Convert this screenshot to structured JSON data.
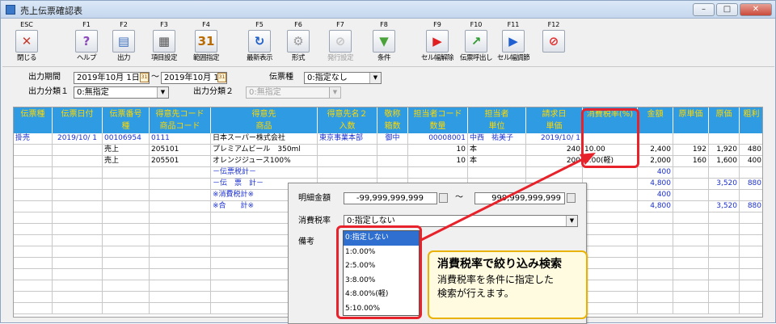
{
  "window": {
    "title": "売上伝票確認表",
    "min": "–",
    "max": "□",
    "close": "✕"
  },
  "toolbar": [
    {
      "key": "ESC",
      "label": "閉じる",
      "icon": "exit-icon",
      "glyph": "✕",
      "color": "#c23a2b",
      "enabled": true
    },
    {
      "key": "F1",
      "label": "ヘルプ",
      "icon": "help-icon",
      "glyph": "?",
      "color": "#8a4ab8",
      "enabled": true
    },
    {
      "key": "F2",
      "label": "出力",
      "icon": "output-icon",
      "glyph": "▤",
      "color": "#3b6fbf",
      "enabled": true
    },
    {
      "key": "F3",
      "label": "項目設定",
      "icon": "column-settings-icon",
      "glyph": "▦",
      "color": "#555555",
      "enabled": true
    },
    {
      "key": "F4",
      "label": "範囲指定",
      "icon": "calendar-icon",
      "glyph": "31",
      "color": "#b86b00",
      "enabled": true
    },
    {
      "key": "F5",
      "label": "最新表示",
      "icon": "refresh-icon",
      "glyph": "↻",
      "color": "#1f5fc8",
      "enabled": true
    },
    {
      "key": "F6",
      "label": "形式",
      "icon": "gear-icon",
      "glyph": "⚙",
      "color": "#9a9a9a",
      "enabled": true
    },
    {
      "key": "F7",
      "label": "発行設定",
      "icon": "disabled-icon",
      "glyph": "⊘",
      "color": "#c4c4c4",
      "enabled": false
    },
    {
      "key": "F8",
      "label": "条件",
      "icon": "filter-icon",
      "glyph": "▼",
      "color": "#4aa33a",
      "enabled": true
    },
    {
      "key": "F9",
      "label": "セル幅解除",
      "icon": "play-red-icon",
      "glyph": "▶",
      "color": "#e02020",
      "enabled": true
    },
    {
      "key": "F10",
      "label": "伝票呼出し",
      "icon": "arrow-up-icon",
      "glyph": "↗",
      "color": "#2f9a2f",
      "enabled": true
    },
    {
      "key": "F11",
      "label": "セル幅調節",
      "icon": "play-blue-icon",
      "glyph": "▶",
      "color": "#1f5fd0",
      "enabled": true
    },
    {
      "key": "F12",
      "label": "",
      "icon": "stop-icon",
      "glyph": "⊘",
      "color": "#e03030",
      "enabled": true
    }
  ],
  "params": {
    "period_label": "出力期間",
    "period_from": "2019年10月 1日",
    "period_sep": "〜",
    "period_to": "2019年10月 1日",
    "slip_type_label": "伝票種",
    "slip_type_value": "0:指定なし",
    "class1_label": "出力分類１",
    "class1_value": "0:無指定",
    "class2_label": "出力分類２",
    "class2_value": "0:無指定",
    "cal_glyph": "31",
    "arrow": "▼"
  },
  "grid": {
    "headers": [
      {
        "l1": "伝票種",
        "l2": ""
      },
      {
        "l1": "伝票日付",
        "l2": ""
      },
      {
        "l1": "伝票番号",
        "l2": "種"
      },
      {
        "l1": "得意先コード",
        "l2": "商品コード"
      },
      {
        "l1": "得意先",
        "l2": "商品"
      },
      {
        "l1": "得意先名２",
        "l2": "入数"
      },
      {
        "l1": "敬称",
        "l2": "箱数"
      },
      {
        "l1": "担当者コード",
        "l2": "数量"
      },
      {
        "l1": "担当者",
        "l2": "単位"
      },
      {
        "l1": "請求日",
        "l2": "単価"
      },
      {
        "l1": "消費税率(%)",
        "l2": ""
      },
      {
        "l1": "金額",
        "l2": ""
      },
      {
        "l1": "原単価",
        "l2": ""
      },
      {
        "l1": "原価",
        "l2": ""
      },
      {
        "l1": "粗利",
        "l2": ""
      }
    ],
    "rows": [
      [
        "掛売",
        "2019/10/ 1",
        "00106954",
        "0111",
        "日本スーパー株式会社",
        "東京事業本部",
        "御中",
        "00008001",
        "中西　祐美子",
        "2019/10/ 1",
        "",
        "",
        "",
        "",
        ""
      ],
      [
        "",
        "",
        "売上",
        "205101",
        "プレミアムビール　350ml",
        "",
        "",
        "10",
        "本",
        "240",
        "10.00",
        "2,400",
        "192",
        "1,920",
        "480"
      ],
      [
        "",
        "",
        "売上",
        "205501",
        "オレンジジュース100%",
        "",
        "",
        "10",
        "本",
        "200",
        "8.00(軽)",
        "2,000",
        "160",
        "1,600",
        "400"
      ],
      [
        "",
        "",
        "",
        "",
        "－伝票税計－",
        "",
        "",
        "",
        "",
        "",
        "",
        "400",
        "",
        "",
        ""
      ],
      [
        "",
        "",
        "",
        "",
        "－伝　票　計－",
        "",
        "",
        "",
        "",
        "",
        "",
        "4,800",
        "",
        "3,520",
        "880"
      ],
      [
        "",
        "",
        "",
        "",
        "※消費税計※",
        "",
        "",
        "",
        "",
        "",
        "",
        "400",
        "",
        "",
        ""
      ],
      [
        "",
        "",
        "",
        "",
        "※合　　計※",
        "",
        "",
        "",
        "",
        "",
        "",
        "4,800",
        "",
        "3,520",
        "880"
      ]
    ],
    "empty_rows": 9
  },
  "popup": {
    "amount_label": "明細金額",
    "amount_from": "-99,999,999,999",
    "amount_sep": "〜",
    "amount_to": "999,999,999,999",
    "tax_label": "消費税率",
    "tax_value": "0:指定しない",
    "note_label": "備考",
    "tax_options": [
      "0:指定しない",
      "1:0.00%",
      "2:5.00%",
      "3:8.00%",
      "4:8.00%(軽)",
      "5:10.00%"
    ]
  },
  "callout": {
    "title": "消費税率で絞り込み検索",
    "body_line1": "消費税率を条件に指定した",
    "body_line2": "検索が行えます。"
  },
  "colors": {
    "header_bg": "#2f9be2",
    "header_text": "#ffd900",
    "highlight": "#e8222b",
    "link_blue": "#1a2fd0"
  }
}
